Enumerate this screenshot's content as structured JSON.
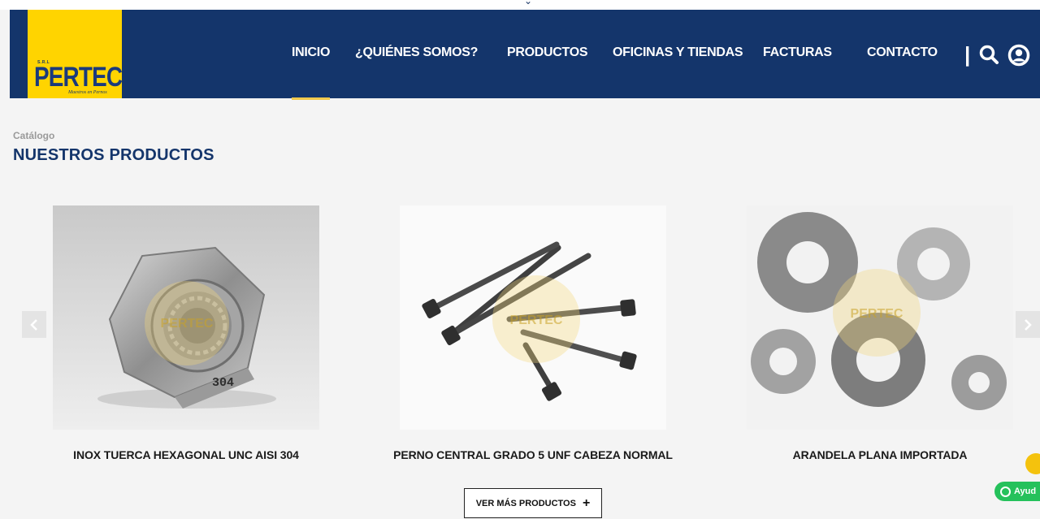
{
  "header": {
    "logo": {
      "brand": "PERTEC",
      "small_text": "S.R.L",
      "tagline": "Maestros en Pernos"
    },
    "nav": [
      {
        "label": "INICIO",
        "active": true
      },
      {
        "label": "¿QUIÉNES SOMOS?",
        "active": false
      },
      {
        "label": "PRODUCTOS",
        "active": false
      },
      {
        "label": "OFICINAS Y TIENDAS",
        "active": false
      },
      {
        "label": "FACTURAS",
        "active": false
      },
      {
        "label": "CONTACTO",
        "active": false
      }
    ],
    "separator": "|",
    "icons": [
      "search-icon",
      "user-account-icon"
    ]
  },
  "section": {
    "breadcrumb": "Catálogo",
    "title": "NUESTROS PRODUCTOS"
  },
  "products": [
    {
      "name": "INOX TUERCA HEXAGONAL UNC AISI 304",
      "image": "hex-nut-photo",
      "stamp": "304"
    },
    {
      "name": "PERNO CENTRAL GRADO 5 UNF CABEZA NORMAL",
      "image": "socket-bolts-photo"
    },
    {
      "name": "ARANDELA PLANA IMPORTADA",
      "image": "flat-washers-photo"
    }
  ],
  "watermark": "PERTEC",
  "carousel": {
    "prev_icon": "chevron-left-icon",
    "next_icon": "chevron-right-icon"
  },
  "more_button": {
    "label": "VER MÁS PRODUCTOS",
    "icon": "+"
  },
  "floating": {
    "whatsapp_label": "Ayud",
    "location_icon": "location-pin-icon"
  },
  "colors": {
    "header_bg": "#14356b",
    "logo_bg": "#ffd400",
    "title": "#14356b",
    "accent": "#f2c94c",
    "whatsapp": "#25c15b"
  }
}
